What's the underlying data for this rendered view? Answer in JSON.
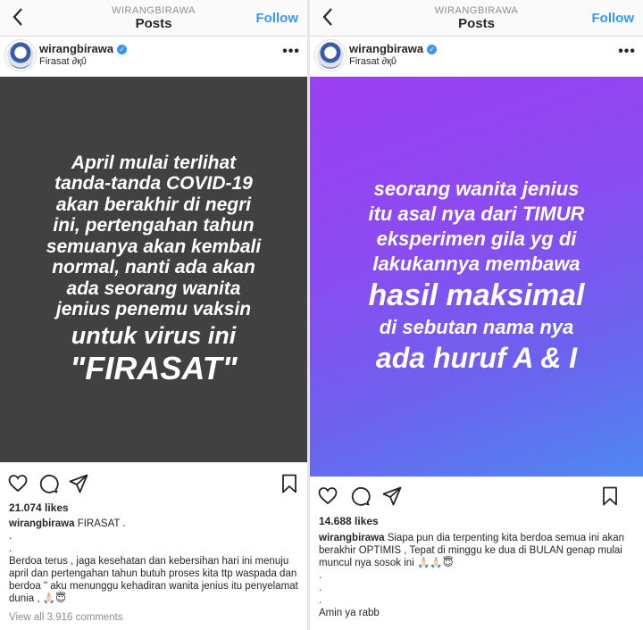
{
  "left": {
    "header": {
      "username_small": "WIRANGBIRAWA",
      "title": "Posts",
      "follow": "Follow"
    },
    "post": {
      "username": "wirangbirawa",
      "location": "Firasat ∂қΰ",
      "image_lines": [
        "April mulai terlihat",
        "tanda-tanda COVID-19",
        "akan berakhir di negri",
        "ini, pertengahan tahun",
        "semuanya akan kembali",
        "normal, nanti ada akan",
        "ada seorang wanita",
        "jenius penemu vaksin",
        "untuk virus ini",
        "\"FIRASAT\""
      ],
      "likes": "21.074 likes",
      "caption_user": "wirangbirawa",
      "caption_text": "FIRASAT .",
      "dots": [
        ".",
        "."
      ],
      "caption_body": "Berdoa terus , jaga kesehatan dan kebersihan hari ini menuju april dan pertengahan tahun butuh proses kita ttp waspada dan berdoa \" aku menunggu kehadiran wanita jenius itu penyelamat dunia , 🙏🏻😇",
      "view_all": "View all 3.916 comments"
    }
  },
  "right": {
    "header": {
      "username_small": "WIRANGBIRAWA",
      "title": "Posts",
      "follow": "Follow"
    },
    "post": {
      "username": "wirangbirawa",
      "location": "Firasat ∂қΰ",
      "image_lines": [
        "seorang wanita jenius",
        "itu asal nya dari TIMUR",
        "eksperimen gila yg di",
        "lakukannya membawa",
        "hasil maksimal",
        "di sebutan nama nya",
        "ada huruf A & I"
      ],
      "likes": "14.688 likes",
      "caption_user": "wirangbirawa",
      "caption_text": "Siapa pun dia terpenting kita berdoa semua ini akan berakhir OPTIMIS , Tepat di minggu ke dua di BULAN genap mulai muncul nya sosok ini 🙏🏻🙏🏻😇",
      "dots": [
        ".",
        ".",
        "."
      ],
      "closing": "Amin ya rabb"
    }
  }
}
